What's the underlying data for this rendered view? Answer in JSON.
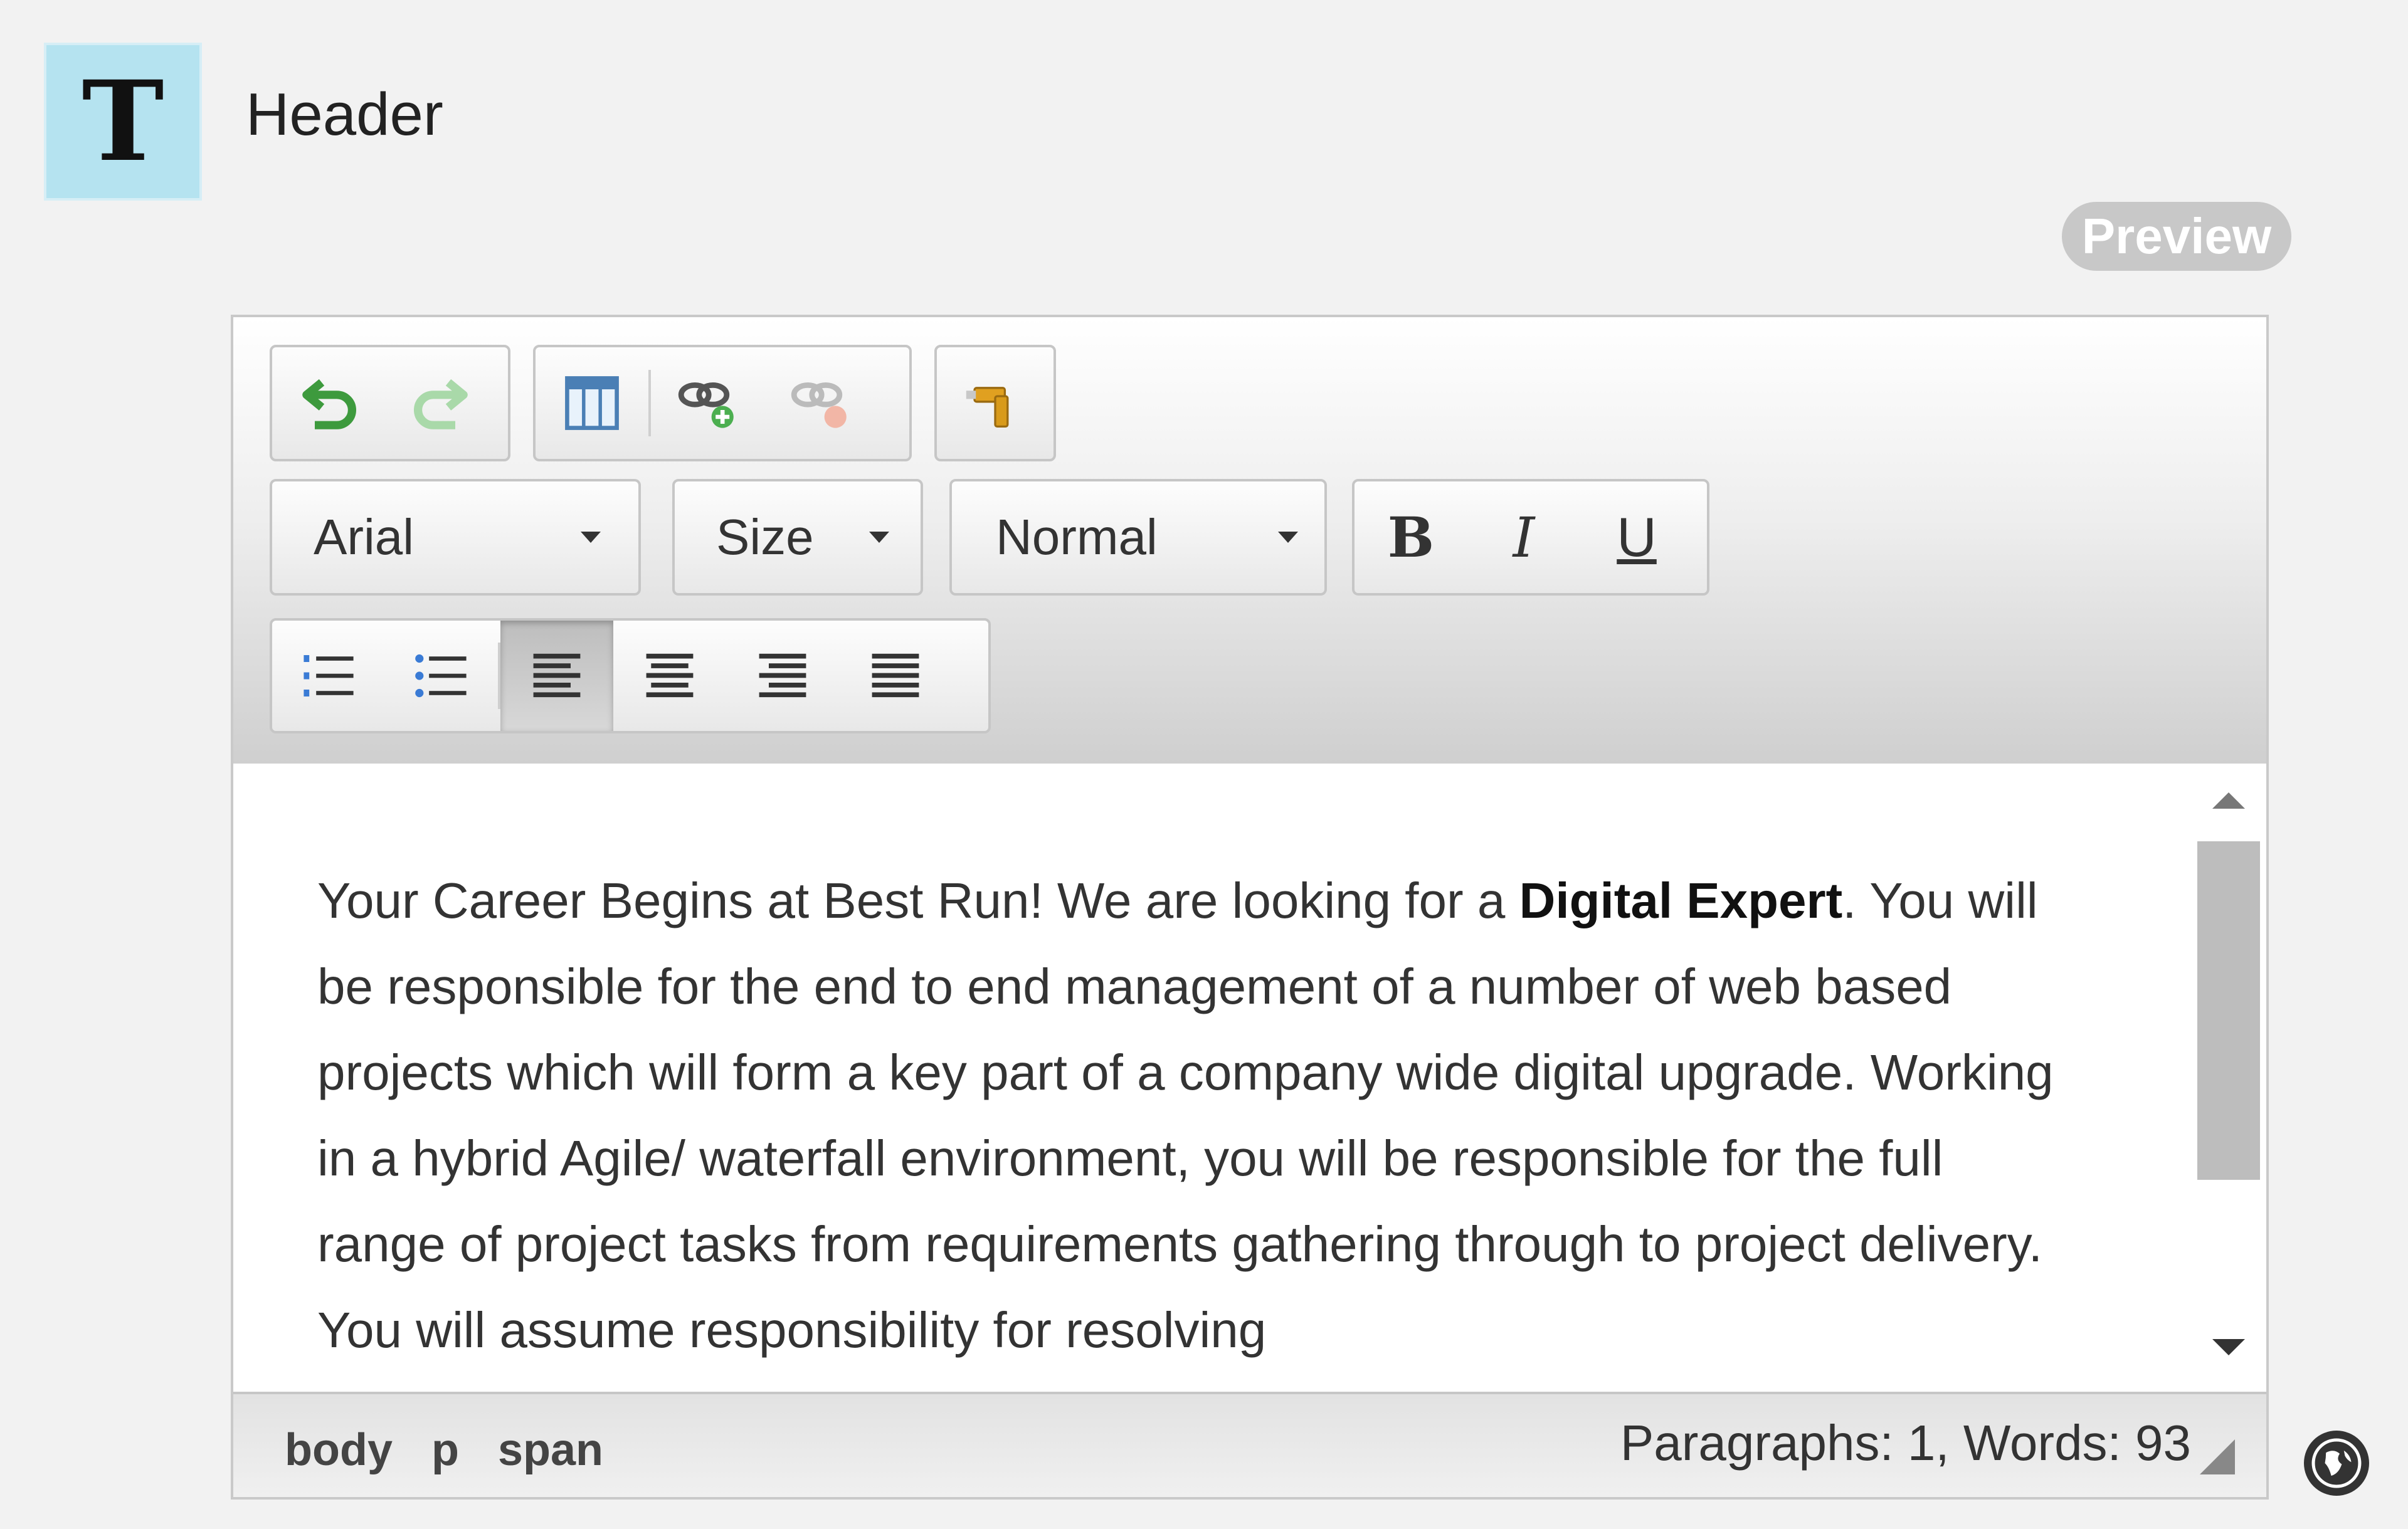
{
  "header": {
    "tile_letter": "T",
    "title": "Header"
  },
  "preview_label": "Preview",
  "toolbar": {
    "row1": {
      "undo_icon": "undo-icon",
      "redo_icon": "redo-icon",
      "table_icon": "table-icon",
      "link_icon": "link-icon",
      "unlink_icon": "unlink-icon",
      "clean_icon": "clean-format-icon"
    },
    "font": {
      "value": "Arial"
    },
    "size": {
      "value": "Size"
    },
    "format": {
      "value": "Normal"
    },
    "bold_label": "B",
    "italic_label": "I",
    "underline_label": "U",
    "lists": [
      "numbered-list-icon",
      "bulleted-list-icon"
    ],
    "align": [
      "align-left-icon",
      "align-center-icon",
      "align-right-icon",
      "align-justify-icon"
    ],
    "active_align": "align-left"
  },
  "content": {
    "pre": "Your Career Begins at Best Run! We are looking for a ",
    "bold": "Digital Expert",
    "post": ". You will be responsible for the end to end management of a number of web based projects which will form a key part of a company wide digital upgrade. Working in a hybrid Agile/ waterfall environment, you will be responsible for the full range of project tasks from requirements gathering through to project delivery. You will assume responsibility for resolving"
  },
  "statusbar": {
    "path": [
      "body",
      "p",
      "span"
    ],
    "wordcount": "Paragraphs: 1, Words: 93"
  },
  "colors": {
    "tile": "#b5e3f0",
    "green_icon": "#4caf50",
    "blue_bullet": "#3a7bd5"
  }
}
